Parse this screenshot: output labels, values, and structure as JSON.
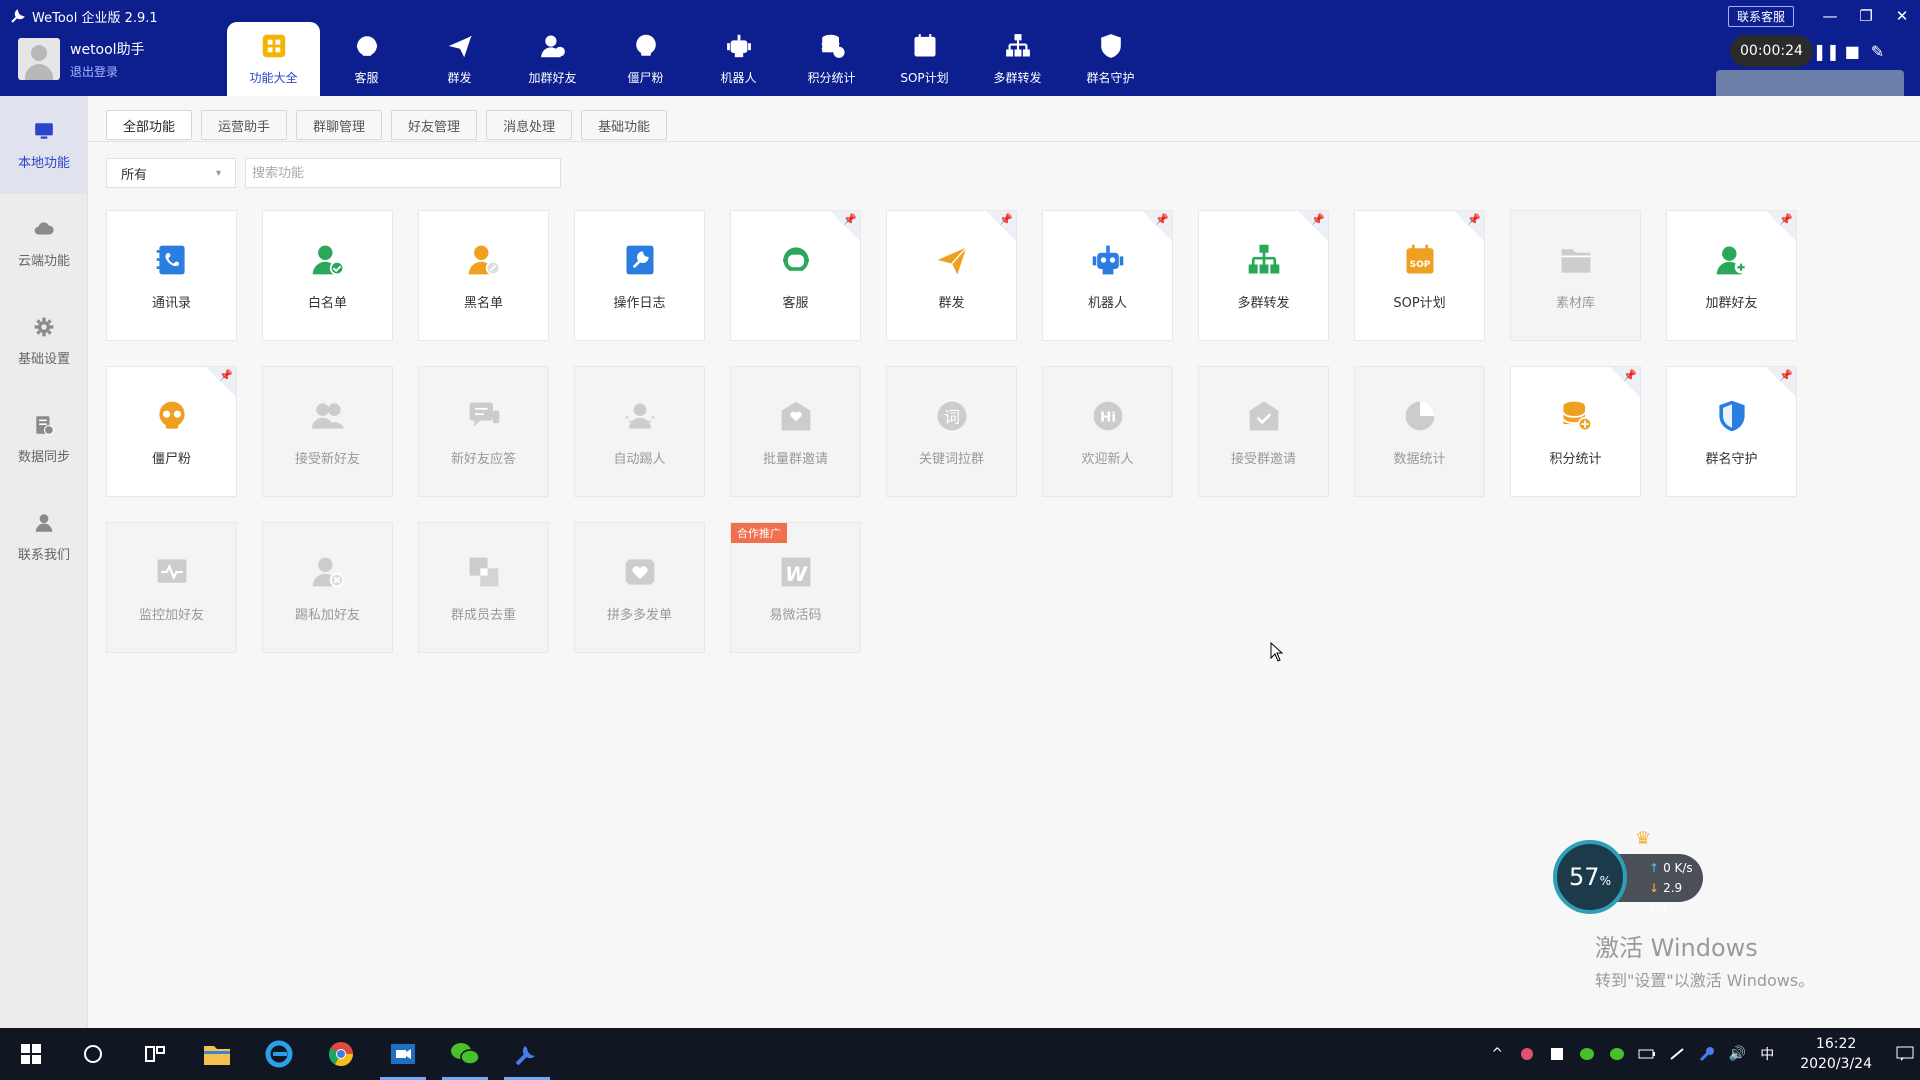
{
  "window": {
    "title": "WeTool 企业版 2.9.1",
    "contact_label": "联系客服",
    "minimize": "—",
    "restore": "❐",
    "close": "✕"
  },
  "user": {
    "name": "wetool助手",
    "logout": "退出登录"
  },
  "topnav": [
    {
      "label": "功能大全",
      "icon": "grid-icon",
      "active": true
    },
    {
      "label": "客服",
      "icon": "headset-icon"
    },
    {
      "label": "群发",
      "icon": "paper-plane-icon"
    },
    {
      "label": "加群好友",
      "icon": "add-user-icon"
    },
    {
      "label": "僵尸粉",
      "icon": "skull-icon"
    },
    {
      "label": "机器人",
      "icon": "robot-icon"
    },
    {
      "label": "积分统计",
      "icon": "coins-icon"
    },
    {
      "label": "SOP计划",
      "icon": "sop-calendar-icon"
    },
    {
      "label": "多群转发",
      "icon": "hierarchy-icon"
    },
    {
      "label": "群名守护",
      "icon": "shield-icon"
    }
  ],
  "recorder": {
    "time": "00:00:24",
    "pause": "❚❚",
    "stop": "■",
    "edit": "✎"
  },
  "sidebar": [
    {
      "label": "本地功能",
      "icon": "monitor-icon",
      "active": true
    },
    {
      "label": "云端功能",
      "icon": "cloud-icon"
    },
    {
      "label": "基础设置",
      "icon": "gear-icon"
    },
    {
      "label": "数据同步",
      "icon": "sync-icon"
    },
    {
      "label": "联系我们",
      "icon": "person-icon"
    }
  ],
  "tabs": [
    {
      "label": "全部功能",
      "active": true
    },
    {
      "label": "运营助手"
    },
    {
      "label": "群聊管理"
    },
    {
      "label": "好友管理"
    },
    {
      "label": "消息处理"
    },
    {
      "label": "基础功能"
    }
  ],
  "filter": {
    "value": "所有",
    "caret": "▾"
  },
  "search": {
    "placeholder": "搜索功能"
  },
  "features": [
    {
      "label": "通讯录",
      "icon": "contacts-icon",
      "color": "#2a7de1",
      "enabled": true,
      "pinned": false
    },
    {
      "label": "白名单",
      "icon": "whitelist-icon",
      "color": "#2aa85a",
      "enabled": true,
      "pinned": false
    },
    {
      "label": "黑名单",
      "icon": "blacklist-icon",
      "color": "#f0a020",
      "enabled": true,
      "pinned": false
    },
    {
      "label": "操作日志",
      "icon": "log-icon",
      "color": "#2a7de1",
      "enabled": true,
      "pinned": false
    },
    {
      "label": "客服",
      "icon": "headset-icon",
      "color": "#2aa85a",
      "enabled": true,
      "pinned": true
    },
    {
      "label": "群发",
      "icon": "paper-plane-icon",
      "color": "#f0a020",
      "enabled": true,
      "pinned": true
    },
    {
      "label": "机器人",
      "icon": "robot-icon",
      "color": "#2a7de1",
      "enabled": true,
      "pinned": true
    },
    {
      "label": "多群转发",
      "icon": "hierarchy-icon",
      "color": "#2aa85a",
      "enabled": true,
      "pinned": true
    },
    {
      "label": "SOP计划",
      "icon": "sop-calendar-icon",
      "color": "#f0a020",
      "enabled": true,
      "pinned": true
    },
    {
      "label": "素材库",
      "icon": "folder-icon",
      "color": "#cccccc",
      "enabled": false,
      "pinned": false
    },
    {
      "label": "加群好友",
      "icon": "add-user-icon",
      "color": "#2aa85a",
      "enabled": true,
      "pinned": true
    },
    {
      "label": "僵尸粉",
      "icon": "skull-icon",
      "color": "#f0a020",
      "enabled": true,
      "pinned": true
    },
    {
      "label": "接受新好友",
      "icon": "users-icon",
      "color": "#cccccc",
      "enabled": false,
      "pinned": false
    },
    {
      "label": "新好友应答",
      "icon": "chat-icon",
      "color": "#cccccc",
      "enabled": false,
      "pinned": false
    },
    {
      "label": "自动踢人",
      "icon": "kick-icon",
      "color": "#cccccc",
      "enabled": false,
      "pinned": false
    },
    {
      "label": "批量群邀请",
      "icon": "envelope-heart-icon",
      "color": "#cccccc",
      "enabled": false,
      "pinned": false
    },
    {
      "label": "关键词拉群",
      "icon": "keyword-icon",
      "color": "#cccccc",
      "enabled": false,
      "pinned": false
    },
    {
      "label": "欢迎新人",
      "icon": "hi-icon",
      "color": "#cccccc",
      "enabled": false,
      "pinned": false
    },
    {
      "label": "接受群邀请",
      "icon": "envelope-check-icon",
      "color": "#cccccc",
      "enabled": false,
      "pinned": false
    },
    {
      "label": "数据统计",
      "icon": "pie-chart-icon",
      "color": "#cccccc",
      "enabled": false,
      "pinned": false
    },
    {
      "label": "积分统计",
      "icon": "coins-icon",
      "color": "#f0a020",
      "enabled": true,
      "pinned": true
    },
    {
      "label": "群名守护",
      "icon": "shield-icon",
      "color": "#2a7de1",
      "enabled": true,
      "pinned": true
    },
    {
      "label": "监控加好友",
      "icon": "monitor-wave-icon",
      "color": "#cccccc",
      "enabled": false,
      "pinned": false
    },
    {
      "label": "踢私加好友",
      "icon": "user-remove-icon",
      "color": "#cccccc",
      "enabled": false,
      "pinned": false
    },
    {
      "label": "群成员去重",
      "icon": "dedupe-icon",
      "color": "#cccccc",
      "enabled": false,
      "pinned": false
    },
    {
      "label": "拼多多发单",
      "icon": "pdd-icon",
      "color": "#cccccc",
      "enabled": false,
      "pinned": false
    },
    {
      "label": "易微活码",
      "icon": "w-logo-icon",
      "color": "#cccccc",
      "enabled": false,
      "pinned": false,
      "badge": "合作推广"
    }
  ],
  "pin_glyph": "📌",
  "netmon": {
    "percent": "57",
    "percent_sign": "%",
    "up": "0 K/s",
    "down": "2.9 K/s",
    "up_arrow": "↑",
    "down_arrow": "↓",
    "vip": "♛"
  },
  "activation": {
    "line1": "激活 Windows",
    "line2": "转到\"设置\"以激活 Windows。"
  },
  "taskbar": {
    "ime": "中",
    "time": "16:22",
    "date": "2020/3/24",
    "chevron": "^",
    "volume": "🔊"
  }
}
